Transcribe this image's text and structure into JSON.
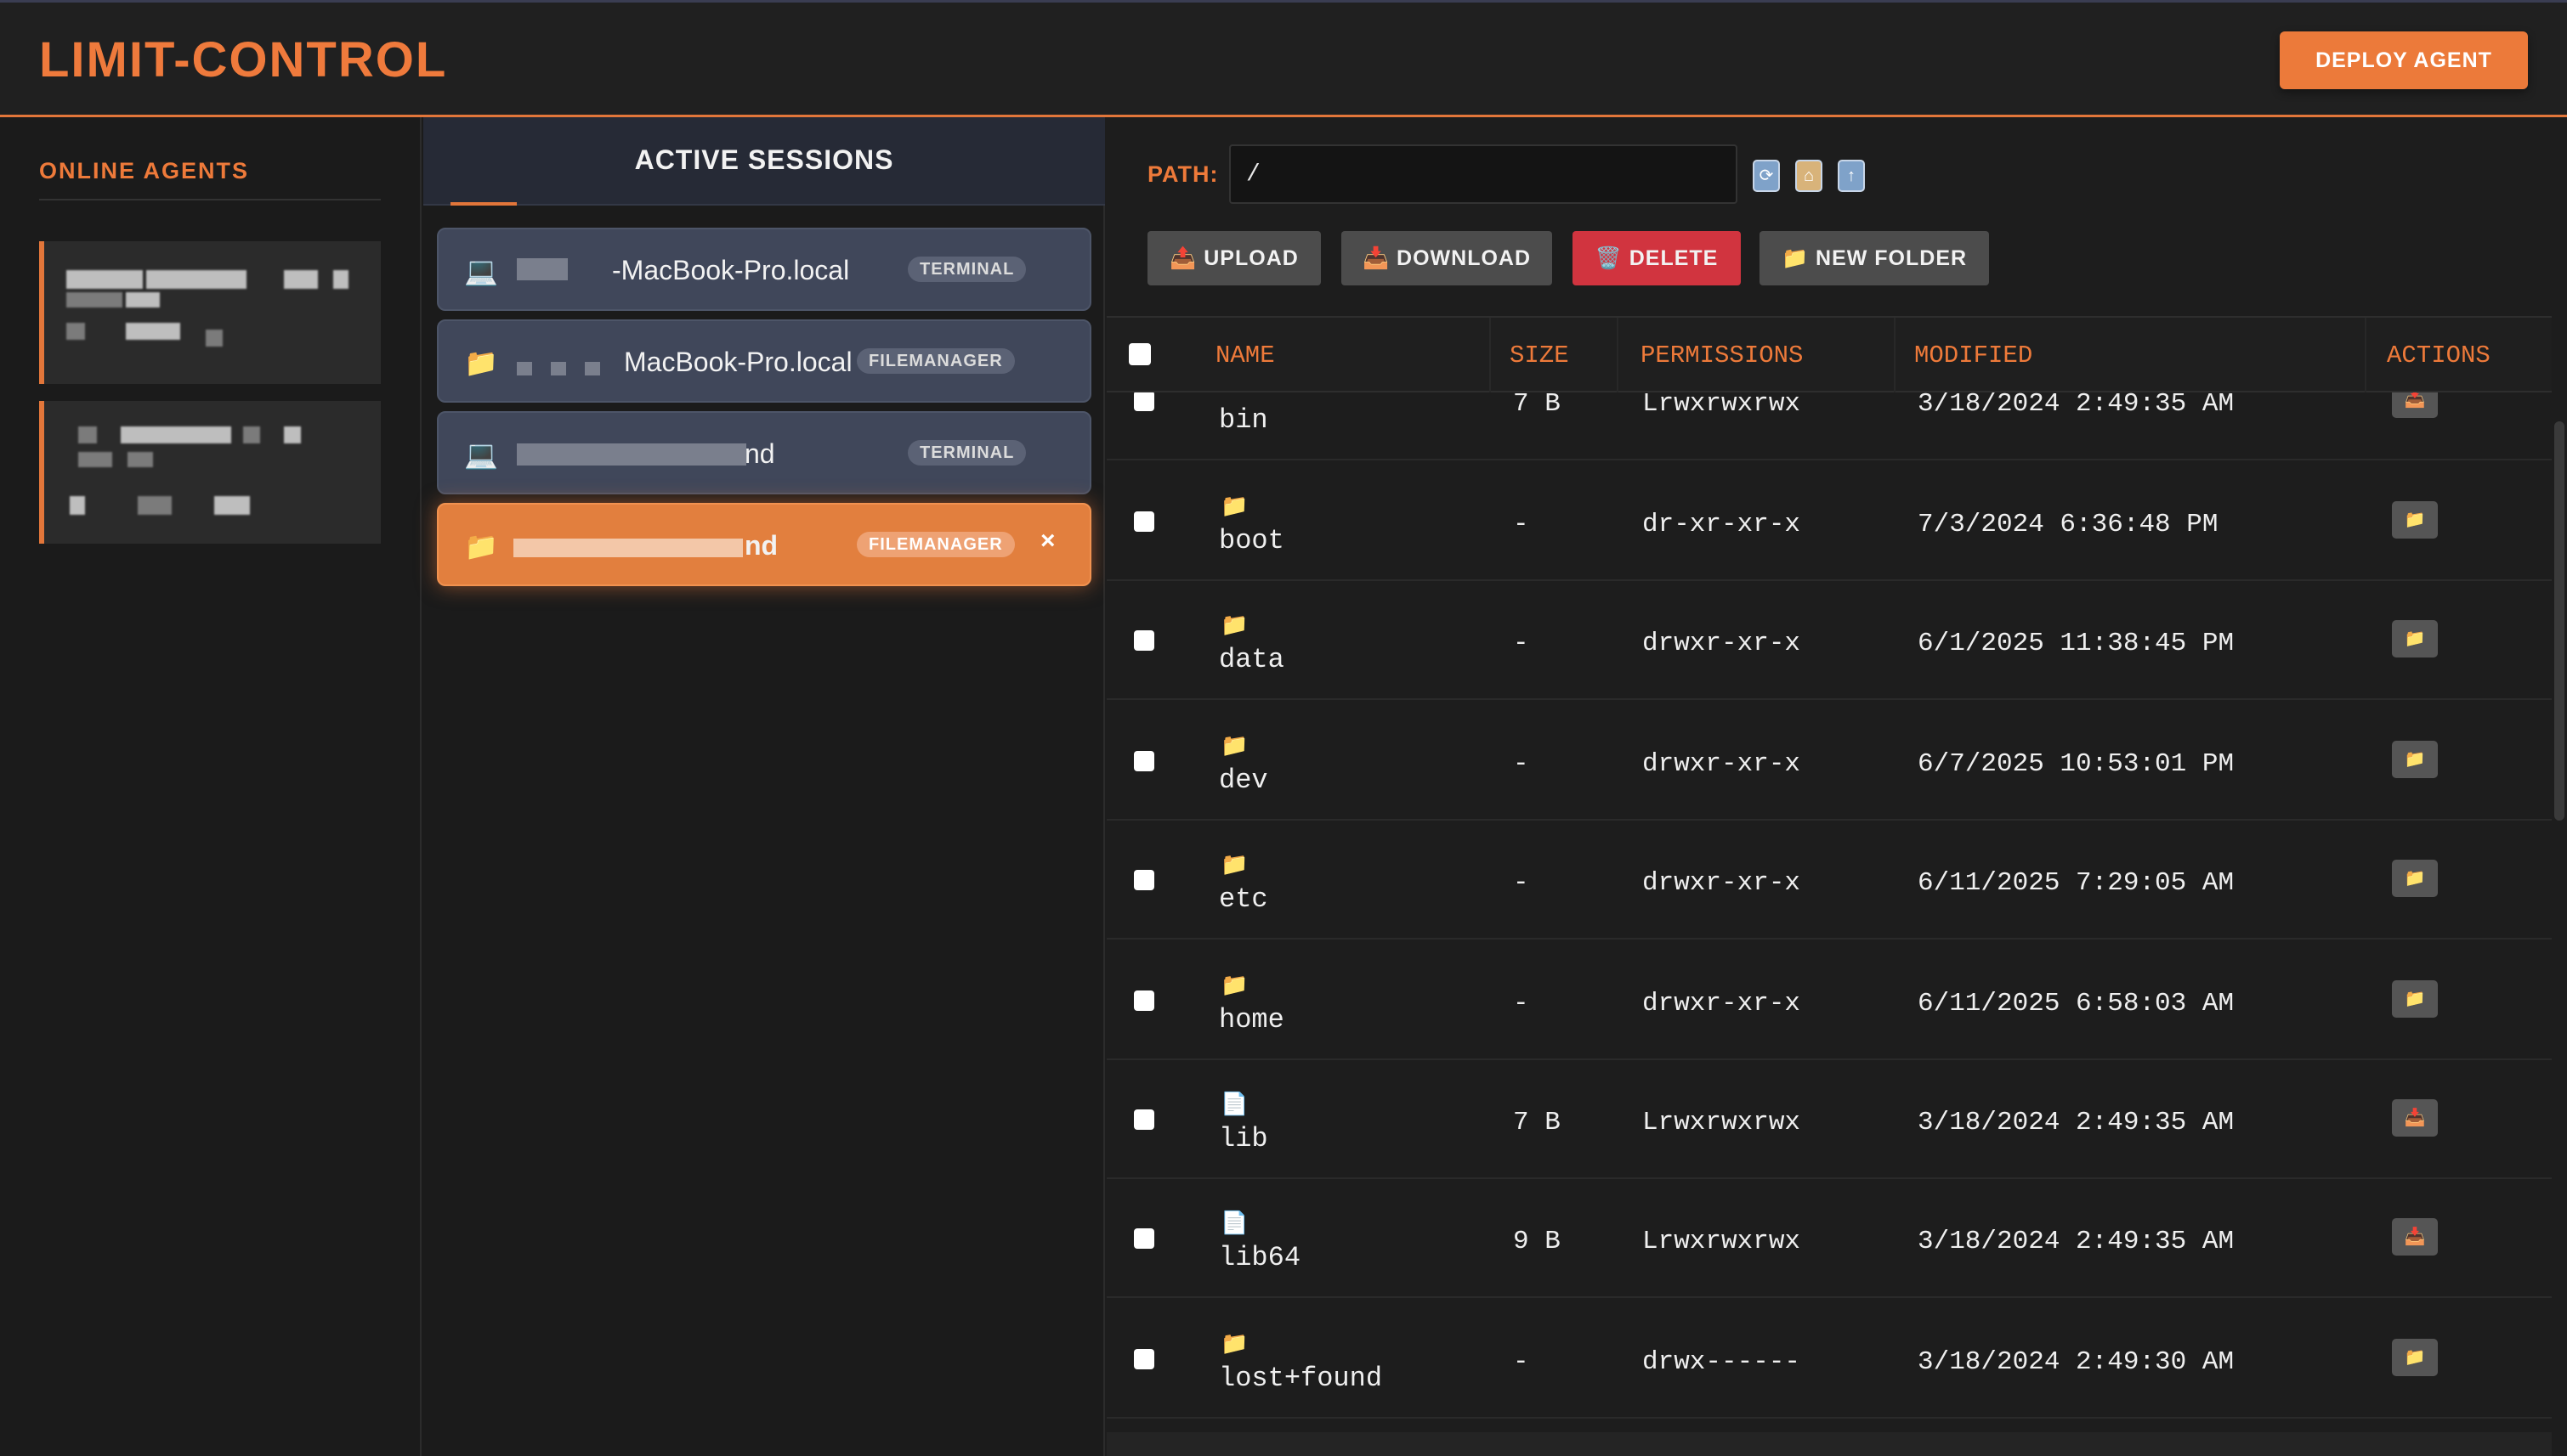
{
  "app": {
    "brand": "LIMIT-CONTROL",
    "deploy_label": "DEPLOY AGENT"
  },
  "agents": {
    "title": "ONLINE AGENTS"
  },
  "sessions": {
    "title": "ACTIVE SESSIONS",
    "items": [
      {
        "icon": "laptop-icon",
        "name": "-MacBook-Pro.local",
        "type": "TERMINAL",
        "active": false
      },
      {
        "icon": "folder-icon",
        "name": "MacBook-Pro.local",
        "type": "FILEMANAGER",
        "active": false
      },
      {
        "icon": "laptop-icon",
        "name": "nd",
        "type": "TERMINAL",
        "active": false
      },
      {
        "icon": "folder-icon",
        "name": "nd",
        "type": "FILEMANAGER",
        "active": true,
        "close": "×"
      }
    ]
  },
  "filemanager": {
    "path_label": "PATH:",
    "path_value": "/",
    "buttons": {
      "upload": "📤 UPLOAD",
      "download": "📥 DOWNLOAD",
      "delete": "🗑️ DELETE",
      "new_folder": "📁 NEW FOLDER"
    },
    "columns": [
      "NAME",
      "SIZE",
      "PERMISSIONS",
      "MODIFIED",
      "ACTIONS"
    ],
    "rows": [
      {
        "type": "file-link",
        "name": "bin",
        "size": "7 B",
        "perm": "Lrwxrwxrwx",
        "modified": "3/18/2024 2:49:35 AM"
      },
      {
        "type": "folder",
        "name": "boot",
        "size": "-",
        "perm": "dr-xr-xr-x",
        "modified": "7/3/2024 6:36:48 PM"
      },
      {
        "type": "folder",
        "name": "data",
        "size": "-",
        "perm": "drwxr-xr-x",
        "modified": "6/1/2025 11:38:45 PM"
      },
      {
        "type": "folder",
        "name": "dev",
        "size": "-",
        "perm": "drwxr-xr-x",
        "modified": "6/7/2025 10:53:01 PM"
      },
      {
        "type": "folder",
        "name": "etc",
        "size": "-",
        "perm": "drwxr-xr-x",
        "modified": "6/11/2025 7:29:05 AM"
      },
      {
        "type": "folder",
        "name": "home",
        "size": "-",
        "perm": "drwxr-xr-x",
        "modified": "6/11/2025 6:58:03 AM"
      },
      {
        "type": "file",
        "name": "lib",
        "size": "7 B",
        "perm": "Lrwxrwxrwx",
        "modified": "3/18/2024 2:49:35 AM"
      },
      {
        "type": "file",
        "name": "lib64",
        "size": "9 B",
        "perm": "Lrwxrwxrwx",
        "modified": "3/18/2024 2:49:35 AM"
      },
      {
        "type": "folder",
        "name": "lost+found",
        "size": "-",
        "perm": "drwx------",
        "modified": "3/18/2024 2:49:30 AM"
      }
    ]
  },
  "colors": {
    "accent": "#e2763a",
    "delete": "#d1343f",
    "background": "#1b1b1b"
  }
}
